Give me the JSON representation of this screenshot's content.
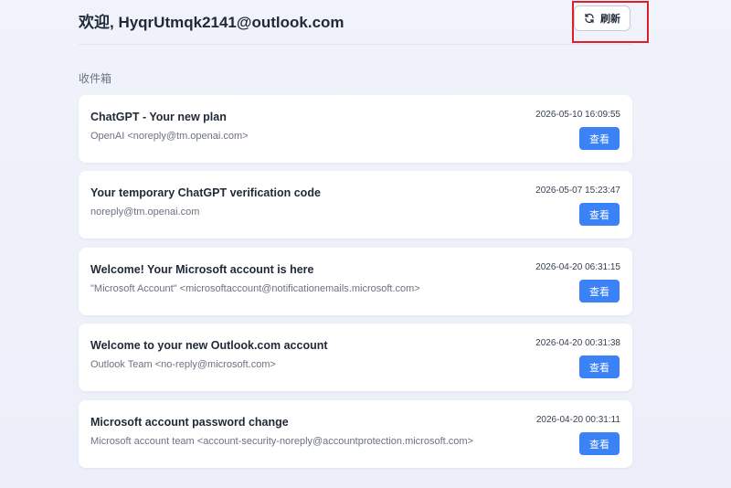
{
  "header": {
    "title": "欢迎, HyqrUtmqk2141@outlook.com",
    "refresh_label": "刷新",
    "refresh_icon": "refresh-icon"
  },
  "inbox": {
    "label": "收件箱",
    "view_label": "查看",
    "emails": [
      {
        "subject": "ChatGPT - Your new plan",
        "sender": "OpenAI <noreply@tm.openai.com>",
        "time": "2026-05-10 16:09:55"
      },
      {
        "subject": "Your temporary ChatGPT verification code",
        "sender": "noreply@tm.openai.com",
        "time": "2026-05-07 15:23:47"
      },
      {
        "subject": "Welcome! Your Microsoft account is here",
        "sender": "\"Microsoft Account\" <microsoftaccount@notificationemails.microsoft.com>",
        "time": "2026-04-20 06:31:15"
      },
      {
        "subject": "Welcome to your new Outlook.com account",
        "sender": "Outlook Team <no-reply@microsoft.com>",
        "time": "2026-04-20 00:31:38"
      },
      {
        "subject": "Microsoft account password change",
        "sender": "Microsoft account team <account-security-noreply@accountprotection.microsoft.com>",
        "time": "2026-04-20 00:31:11"
      }
    ]
  },
  "colors": {
    "accent": "#3b82f6",
    "highlight": "#e11d2a"
  }
}
